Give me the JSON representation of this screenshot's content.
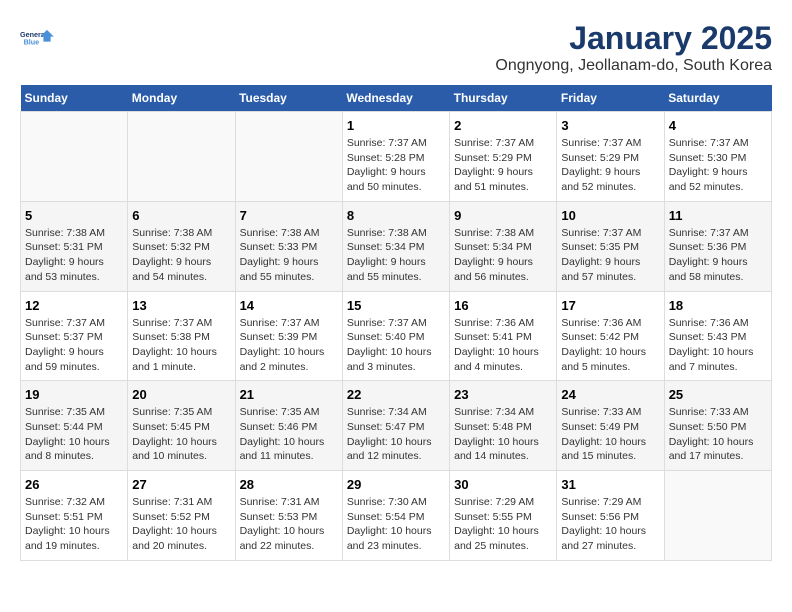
{
  "logo": {
    "line1": "General",
    "line2": "Blue"
  },
  "title": "January 2025",
  "subtitle": "Ongnyong, Jeollanam-do, South Korea",
  "weekdays": [
    "Sunday",
    "Monday",
    "Tuesday",
    "Wednesday",
    "Thursday",
    "Friday",
    "Saturday"
  ],
  "weeks": [
    [
      {
        "day": "",
        "details": ""
      },
      {
        "day": "",
        "details": ""
      },
      {
        "day": "",
        "details": ""
      },
      {
        "day": "1",
        "details": "Sunrise: 7:37 AM\nSunset: 5:28 PM\nDaylight: 9 hours\nand 50 minutes."
      },
      {
        "day": "2",
        "details": "Sunrise: 7:37 AM\nSunset: 5:29 PM\nDaylight: 9 hours\nand 51 minutes."
      },
      {
        "day": "3",
        "details": "Sunrise: 7:37 AM\nSunset: 5:29 PM\nDaylight: 9 hours\nand 52 minutes."
      },
      {
        "day": "4",
        "details": "Sunrise: 7:37 AM\nSunset: 5:30 PM\nDaylight: 9 hours\nand 52 minutes."
      }
    ],
    [
      {
        "day": "5",
        "details": "Sunrise: 7:38 AM\nSunset: 5:31 PM\nDaylight: 9 hours\nand 53 minutes."
      },
      {
        "day": "6",
        "details": "Sunrise: 7:38 AM\nSunset: 5:32 PM\nDaylight: 9 hours\nand 54 minutes."
      },
      {
        "day": "7",
        "details": "Sunrise: 7:38 AM\nSunset: 5:33 PM\nDaylight: 9 hours\nand 55 minutes."
      },
      {
        "day": "8",
        "details": "Sunrise: 7:38 AM\nSunset: 5:34 PM\nDaylight: 9 hours\nand 55 minutes."
      },
      {
        "day": "9",
        "details": "Sunrise: 7:38 AM\nSunset: 5:34 PM\nDaylight: 9 hours\nand 56 minutes."
      },
      {
        "day": "10",
        "details": "Sunrise: 7:37 AM\nSunset: 5:35 PM\nDaylight: 9 hours\nand 57 minutes."
      },
      {
        "day": "11",
        "details": "Sunrise: 7:37 AM\nSunset: 5:36 PM\nDaylight: 9 hours\nand 58 minutes."
      }
    ],
    [
      {
        "day": "12",
        "details": "Sunrise: 7:37 AM\nSunset: 5:37 PM\nDaylight: 9 hours\nand 59 minutes."
      },
      {
        "day": "13",
        "details": "Sunrise: 7:37 AM\nSunset: 5:38 PM\nDaylight: 10 hours\nand 1 minute."
      },
      {
        "day": "14",
        "details": "Sunrise: 7:37 AM\nSunset: 5:39 PM\nDaylight: 10 hours\nand 2 minutes."
      },
      {
        "day": "15",
        "details": "Sunrise: 7:37 AM\nSunset: 5:40 PM\nDaylight: 10 hours\nand 3 minutes."
      },
      {
        "day": "16",
        "details": "Sunrise: 7:36 AM\nSunset: 5:41 PM\nDaylight: 10 hours\nand 4 minutes."
      },
      {
        "day": "17",
        "details": "Sunrise: 7:36 AM\nSunset: 5:42 PM\nDaylight: 10 hours\nand 5 minutes."
      },
      {
        "day": "18",
        "details": "Sunrise: 7:36 AM\nSunset: 5:43 PM\nDaylight: 10 hours\nand 7 minutes."
      }
    ],
    [
      {
        "day": "19",
        "details": "Sunrise: 7:35 AM\nSunset: 5:44 PM\nDaylight: 10 hours\nand 8 minutes."
      },
      {
        "day": "20",
        "details": "Sunrise: 7:35 AM\nSunset: 5:45 PM\nDaylight: 10 hours\nand 10 minutes."
      },
      {
        "day": "21",
        "details": "Sunrise: 7:35 AM\nSunset: 5:46 PM\nDaylight: 10 hours\nand 11 minutes."
      },
      {
        "day": "22",
        "details": "Sunrise: 7:34 AM\nSunset: 5:47 PM\nDaylight: 10 hours\nand 12 minutes."
      },
      {
        "day": "23",
        "details": "Sunrise: 7:34 AM\nSunset: 5:48 PM\nDaylight: 10 hours\nand 14 minutes."
      },
      {
        "day": "24",
        "details": "Sunrise: 7:33 AM\nSunset: 5:49 PM\nDaylight: 10 hours\nand 15 minutes."
      },
      {
        "day": "25",
        "details": "Sunrise: 7:33 AM\nSunset: 5:50 PM\nDaylight: 10 hours\nand 17 minutes."
      }
    ],
    [
      {
        "day": "26",
        "details": "Sunrise: 7:32 AM\nSunset: 5:51 PM\nDaylight: 10 hours\nand 19 minutes."
      },
      {
        "day": "27",
        "details": "Sunrise: 7:31 AM\nSunset: 5:52 PM\nDaylight: 10 hours\nand 20 minutes."
      },
      {
        "day": "28",
        "details": "Sunrise: 7:31 AM\nSunset: 5:53 PM\nDaylight: 10 hours\nand 22 minutes."
      },
      {
        "day": "29",
        "details": "Sunrise: 7:30 AM\nSunset: 5:54 PM\nDaylight: 10 hours\nand 23 minutes."
      },
      {
        "day": "30",
        "details": "Sunrise: 7:29 AM\nSunset: 5:55 PM\nDaylight: 10 hours\nand 25 minutes."
      },
      {
        "day": "31",
        "details": "Sunrise: 7:29 AM\nSunset: 5:56 PM\nDaylight: 10 hours\nand 27 minutes."
      },
      {
        "day": "",
        "details": ""
      }
    ]
  ]
}
